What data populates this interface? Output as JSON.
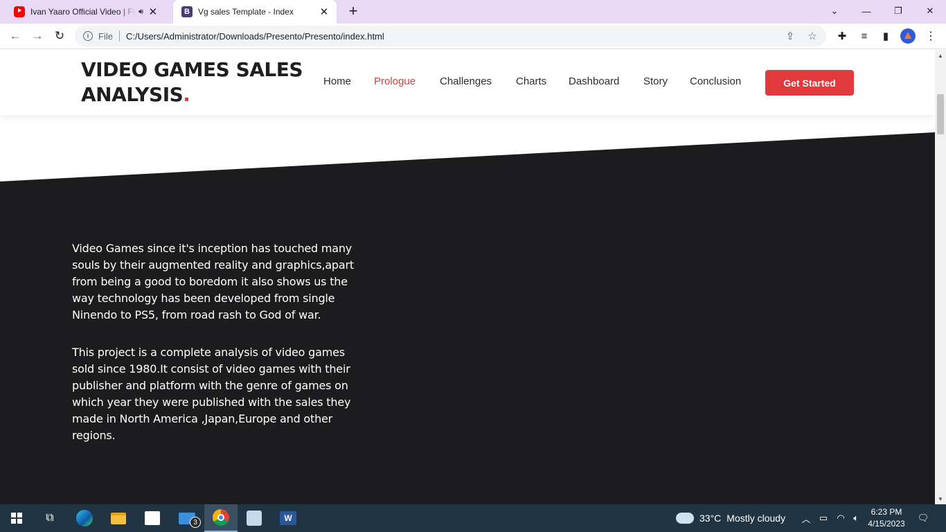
{
  "browser": {
    "tabs": [
      {
        "title": "Ivan Yaaro Official Video | Fu",
        "favicon": "youtube-icon",
        "audio": true
      },
      {
        "title": "Vg sales Template - Index",
        "favicon": "bootstrap-icon",
        "active": true
      }
    ],
    "new_tab_label": "+",
    "address": {
      "scheme_label": "File",
      "url": "C:/Users/Administrator/Downloads/Presento/Presento/index.html"
    },
    "window_controls": {
      "chevron": "⌄",
      "minimize": "—",
      "maximize": "❐",
      "close": "✕"
    }
  },
  "site": {
    "logo_text": "VIDEO GAMES SALES ANALYSIS",
    "logo_dot": ".",
    "nav": [
      {
        "label": "Home",
        "active": false
      },
      {
        "label": "Prologue",
        "active": true
      },
      {
        "label": "Challenges",
        "active": false
      },
      {
        "label": "Charts",
        "active": false
      },
      {
        "label": "Dashboard",
        "active": false
      },
      {
        "label": "Story",
        "active": false
      },
      {
        "label": "Conclusion",
        "active": false
      }
    ],
    "cta_label": "Get Started",
    "accent_color": "#e03a3c",
    "dark_bg_color": "#1c1c1e",
    "paragraphs": [
      "Video Games since it's inception has touched many souls by their augmented reality and graphics,apart from being a good to boredom it also shows us the way technology has been developed from single Ninendo to PS5, from road rash to God of war.",
      "This project is a complete analysis of video games sold since 1980.It consist of video games with their publisher and platform with the genre of games on which year they were published with the sales they made in North America ,Japan,Europe and other regions."
    ]
  },
  "taskbar": {
    "apps": [
      "start-icon",
      "task-view-icon",
      "edge-icon",
      "file-explorer-icon",
      "store-icon",
      "mail-icon",
      "chrome-icon",
      "snipping-tool-icon",
      "word-icon"
    ],
    "mail_badge": "3",
    "weather": {
      "temp": "33°C",
      "condition": "Mostly cloudy"
    },
    "time": "6:23 PM",
    "date": "4/15/2023"
  }
}
